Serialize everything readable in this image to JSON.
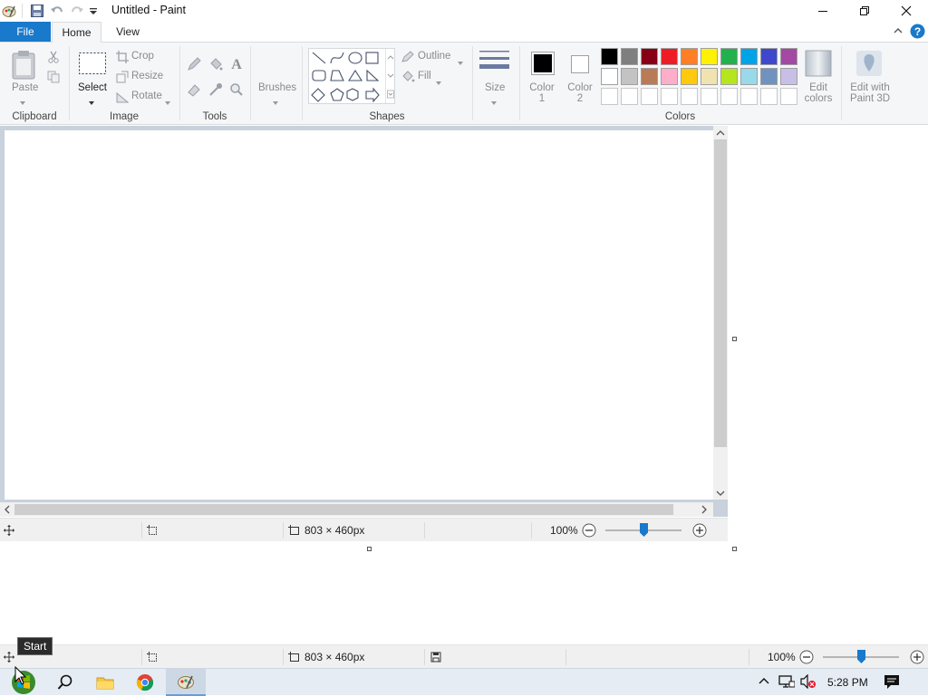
{
  "window": {
    "title": "Untitled - Paint",
    "controls": {
      "minimize": "minimize",
      "maximize": "restore",
      "close": "close"
    }
  },
  "tabs": [
    {
      "label": "File"
    },
    {
      "label": "Home"
    },
    {
      "label": "View"
    }
  ],
  "ribbon": {
    "clipboard": {
      "paste": "Paste",
      "group": "Clipboard"
    },
    "image": {
      "select": "Select",
      "crop": "Crop",
      "resize": "Resize",
      "rotate": "Rotate",
      "group": "Image"
    },
    "tools": {
      "group": "Tools"
    },
    "brushes": {
      "label": "Brushes"
    },
    "shapes": {
      "outline": "Outline",
      "fill": "Fill",
      "group": "Shapes"
    },
    "size": {
      "label": "Size"
    },
    "colors": {
      "color1_line1": "Color",
      "color1_line2": "1",
      "color2_line1": "Color",
      "color2_line2": "2",
      "group": "Colors",
      "edit_line1": "Edit",
      "edit_line2": "colors",
      "paint3d_line1": "Edit with",
      "paint3d_line2": "Paint 3D",
      "palette_row1": [
        "#000000",
        "#7f7f7f",
        "#880015",
        "#ed1c24",
        "#ff7f27",
        "#fff200",
        "#22b14c",
        "#00a2e8",
        "#3f48cc",
        "#a349a4"
      ],
      "palette_row2": [
        "#ffffff",
        "#c3c3c3",
        "#b97a57",
        "#ffaec9",
        "#ffc90e",
        "#efe4b0",
        "#b5e61d",
        "#99d9ea",
        "#7092be",
        "#c8bfe7"
      ]
    }
  },
  "statusbar_top": {
    "size": "803 × 460px",
    "zoom": "100%"
  },
  "statusbar_bottom": {
    "size": "803 × 460px",
    "zoom": "100%"
  },
  "tooltip": {
    "text": "Start"
  },
  "taskbar": {
    "clock": "5:28 PM"
  }
}
